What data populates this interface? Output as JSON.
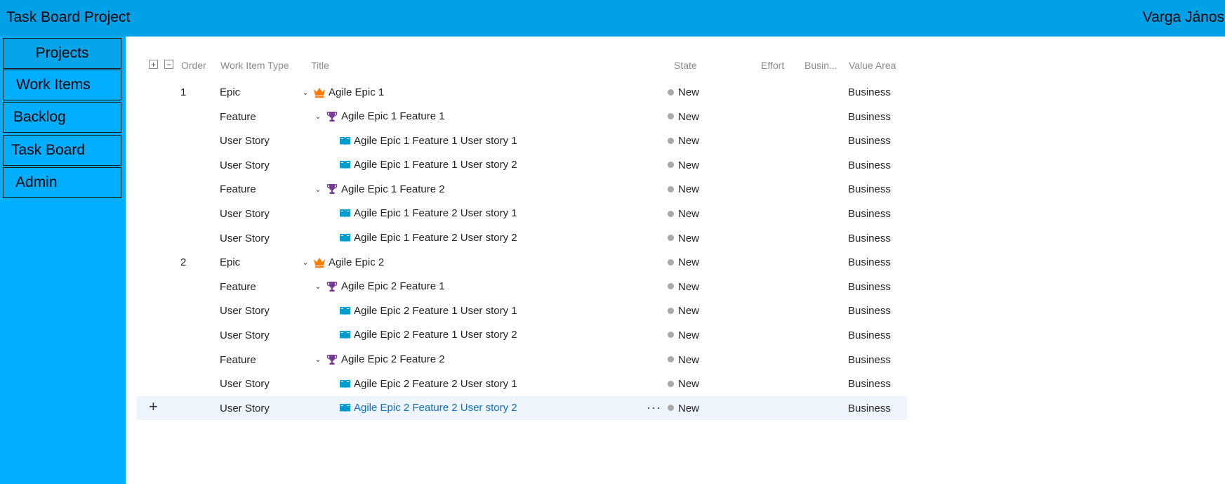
{
  "header": {
    "title": "Task Board Project",
    "user": "Varga János"
  },
  "sidebar": {
    "items": [
      {
        "label": "Projects"
      },
      {
        "label": "Work Items"
      },
      {
        "label": "Backlog"
      },
      {
        "label": "Task Board"
      },
      {
        "label": "Admin"
      }
    ]
  },
  "grid": {
    "columns": {
      "order": "Order",
      "type": "Work Item Type",
      "title": "Title",
      "state": "State",
      "effort": "Effort",
      "business": "Busin...",
      "value_area": "Value Area"
    },
    "expand_icon": "plus-box-icon",
    "collapse_icon": "minus-box-icon",
    "rows": [
      {
        "order": "1",
        "type": "Epic",
        "title": "Agile Epic 1",
        "state": "New",
        "value_area": "Business",
        "icon": "crown-icon"
      },
      {
        "order": "",
        "type": "Feature",
        "title": "Agile Epic 1 Feature 1",
        "state": "New",
        "value_area": "Business",
        "icon": "trophy-icon"
      },
      {
        "order": "",
        "type": "User Story",
        "title": "Agile Epic 1 Feature 1 User story 1",
        "state": "New",
        "value_area": "Business",
        "icon": "book-icon"
      },
      {
        "order": "",
        "type": "User Story",
        "title": "Agile Epic 1 Feature 1 User story 2",
        "state": "New",
        "value_area": "Business",
        "icon": "book-icon"
      },
      {
        "order": "",
        "type": "Feature",
        "title": "Agile Epic 1 Feature 2",
        "state": "New",
        "value_area": "Business",
        "icon": "trophy-icon"
      },
      {
        "order": "",
        "type": "User Story",
        "title": "Agile Epic 1 Feature 2 User story 1",
        "state": "New",
        "value_area": "Business",
        "icon": "book-icon"
      },
      {
        "order": "",
        "type": "User Story",
        "title": "Agile Epic 1 Feature 2 User story 2",
        "state": "New",
        "value_area": "Business",
        "icon": "book-icon"
      },
      {
        "order": "2",
        "type": "Epic",
        "title": "Agile Epic 2",
        "state": "New",
        "value_area": "Business",
        "icon": "crown-icon"
      },
      {
        "order": "",
        "type": "Feature",
        "title": "Agile Epic 2 Feature 1",
        "state": "New",
        "value_area": "Business",
        "icon": "trophy-icon"
      },
      {
        "order": "",
        "type": "User Story",
        "title": "Agile Epic 2 Feature 1 User story 1",
        "state": "New",
        "value_area": "Business",
        "icon": "book-icon"
      },
      {
        "order": "",
        "type": "User Story",
        "title": "Agile Epic 2 Feature 1 User story 2",
        "state": "New",
        "value_area": "Business",
        "icon": "book-icon"
      },
      {
        "order": "",
        "type": "Feature",
        "title": "Agile Epic 2 Feature 2",
        "state": "New",
        "value_area": "Business",
        "icon": "trophy-icon"
      },
      {
        "order": "",
        "type": "User Story",
        "title": "Agile Epic 2 Feature 2 User story 1",
        "state": "New",
        "value_area": "Business",
        "icon": "book-icon"
      },
      {
        "order": "",
        "type": "User Story",
        "title": "Agile Epic 2 Feature 2 User story 2",
        "state": "New",
        "value_area": "Business",
        "icon": "book-icon",
        "selected": true
      }
    ]
  },
  "colors": {
    "topbar": "#00a1e6",
    "sidebar": "#00aeff",
    "epic": "#ff7b00",
    "feature": "#773b93",
    "story": "#009ccc",
    "state_new": "#a9a9a9",
    "selected_row": "#eef5fc"
  }
}
